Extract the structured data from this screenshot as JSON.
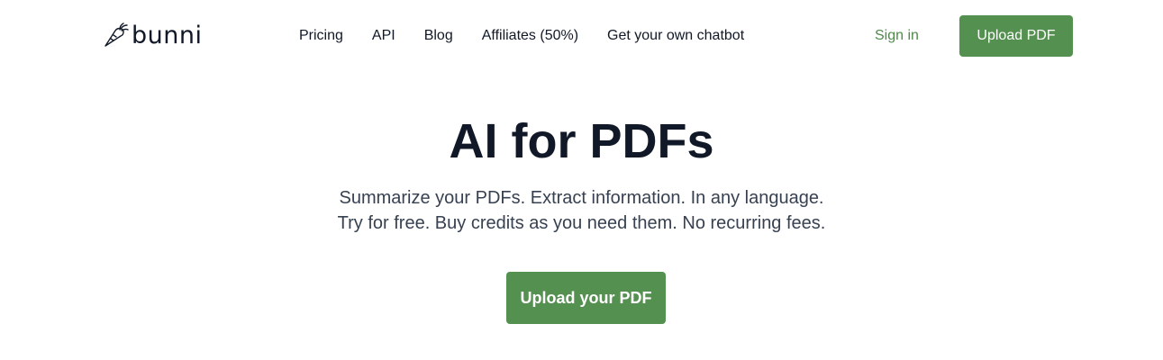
{
  "header": {
    "logo_text": "bunni",
    "logo_icon": "carrot-icon",
    "nav": [
      {
        "label": "Pricing"
      },
      {
        "label": "API"
      },
      {
        "label": "Blog"
      },
      {
        "label": "Affiliates (50%)"
      },
      {
        "label": "Get your own chatbot"
      }
    ],
    "sign_in_label": "Sign in",
    "upload_label": "Upload PDF"
  },
  "hero": {
    "title": "AI for PDFs",
    "subtitle_line1": "Summarize your PDFs. Extract information. In any language.",
    "subtitle_line2": "Try for free. Buy credits as you need them. No recurring fees.",
    "cta_label": "Upload your PDF"
  },
  "colors": {
    "accent": "#54904f",
    "sign_in_text": "#4f8a4b",
    "heading": "#111827",
    "body_text": "#374151",
    "background": "#ffffff"
  }
}
